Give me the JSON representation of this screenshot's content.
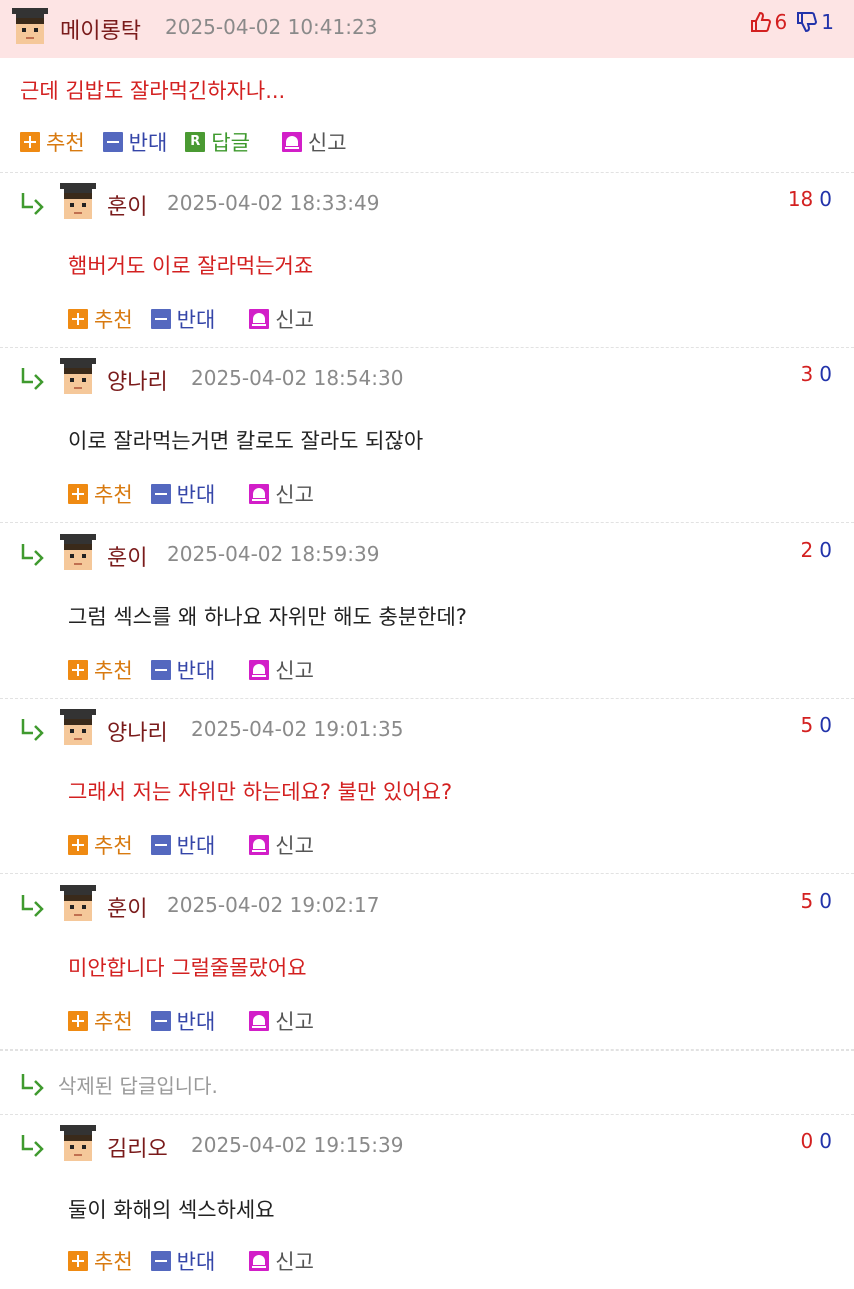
{
  "main_comment": {
    "nickname": "메이롱탁",
    "date": "2025-04-02 10:41:23",
    "upvotes": "6",
    "downvotes": "1",
    "text": "근데 김밥도 잘라먹긴하자나...",
    "actions": {
      "recommend": "추천",
      "oppose": "반대",
      "reply": "답글",
      "report": "신고"
    },
    "reply_icon_letter": "R"
  },
  "replies": [
    {
      "nickname": "훈이",
      "date": "2025-04-02 18:33:49",
      "up": "18",
      "down": "0",
      "text": "햄버거도 이로 잘라먹는거죠",
      "text_color": "#d32020"
    },
    {
      "nickname": "양나리",
      "date": "2025-04-02 18:54:30",
      "up": "3",
      "down": "0",
      "text": "이로 잘라먹는거면 칼로도 잘라도 되잖아",
      "text_color": "#222222"
    },
    {
      "nickname": "훈이",
      "date": "2025-04-02 18:59:39",
      "up": "2",
      "down": "0",
      "text": "그럼 섹스를 왜 하나요 자위만 해도 충분한데?",
      "text_color": "#222222"
    },
    {
      "nickname": "양나리",
      "date": "2025-04-02 19:01:35",
      "up": "5",
      "down": "0",
      "text": "그래서 저는 자위만 하는데요? 불만 있어요?",
      "text_color": "#d32020"
    },
    {
      "nickname": "훈이",
      "date": "2025-04-02 19:02:17",
      "up": "5",
      "down": "0",
      "text": "미안합니다 그럴줄몰랐어요",
      "text_color": "#d32020"
    }
  ],
  "deleted_reply": {
    "text": "삭제된 답글입니다."
  },
  "last_reply": {
    "nickname": "김리오",
    "date": "2025-04-02 19:15:39",
    "up": "0",
    "down": "0",
    "text": "둘이 화해의 섹스하세요",
    "text_color": "#222222"
  },
  "reply_actions": {
    "recommend": "추천",
    "oppose": "반대",
    "report": "신고"
  },
  "colors": {
    "header_bg": "#fde4e4",
    "up": "#d32020",
    "down": "#2233aa",
    "recommend": "#ef8a12",
    "oppose": "#5468bf",
    "report": "#d21ec8",
    "reply_arrow": "#3f9a2e"
  }
}
